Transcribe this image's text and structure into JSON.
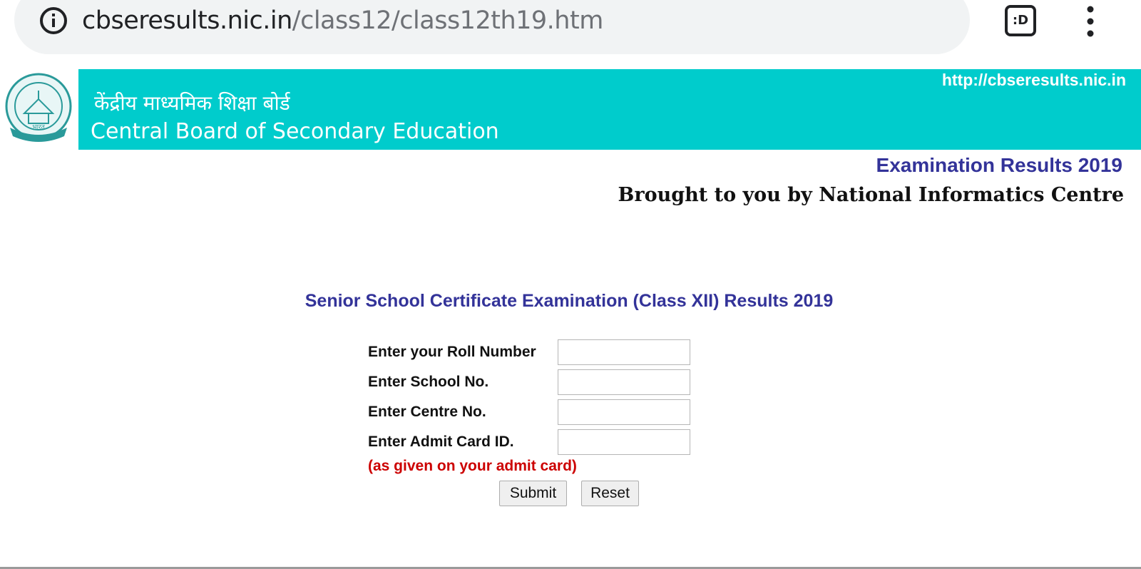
{
  "browser": {
    "url_domain": "cbseresults.nic.in",
    "url_path": "/class12/class12th19.htm",
    "tab_icon_label": ":D",
    "icons": {
      "info": "info-icon",
      "tabs": "tab-switcher-icon",
      "menu": "more-vert-icon"
    }
  },
  "header": {
    "site_url": "http://cbseresults.nic.in",
    "hindi_title": "केंद्रीय माध्यमिक शिक्षा बोर्ड",
    "english_title": "Central Board of Secondary Education",
    "logo_text": "भारत",
    "banner_color": "#00cccc"
  },
  "subheader": {
    "exam_results": "Examination Results 2019",
    "brought_by": "Brought to you by National Informatics Centre"
  },
  "form": {
    "title": "Senior School Certificate Examination (Class XII) Results 2019",
    "fields": [
      {
        "label": "Enter your Roll Number",
        "value": ""
      },
      {
        "label": "Enter School No.",
        "value": ""
      },
      {
        "label": "Enter Centre No.",
        "value": ""
      },
      {
        "label": "Enter Admit Card ID.",
        "value": ""
      }
    ],
    "note": "(as given on your admit card)",
    "submit_label": "Submit",
    "reset_label": "Reset"
  },
  "colors": {
    "accent_blue": "#333399",
    "note_red": "#cc0000"
  }
}
